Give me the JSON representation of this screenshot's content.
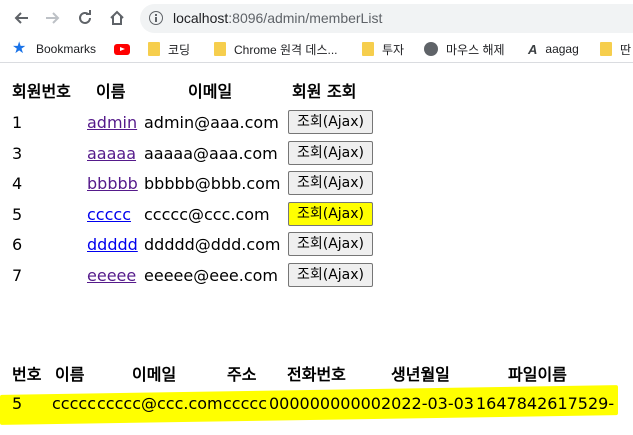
{
  "browser": {
    "url_host": "localhost",
    "url_path": ":8096/admin/memberList",
    "bookmarks": [
      {
        "icon": "star-icon",
        "label": "Bookmarks"
      },
      {
        "icon": "youtube-icon",
        "label": ""
      },
      {
        "icon": "folder-icon",
        "label": "코딩"
      },
      {
        "icon": "folder-icon",
        "label": "Chrome 원격 데스..."
      },
      {
        "icon": "folder-icon",
        "label": "투자"
      },
      {
        "icon": "globe-icon",
        "label": "마우스 해제"
      },
      {
        "icon": "aa-icon",
        "label": "aagag"
      },
      {
        "icon": "folder-icon",
        "label": "딴"
      }
    ]
  },
  "member_table": {
    "headers": [
      "회원번호",
      "이름",
      "이메일",
      "회원 조회"
    ],
    "rows": [
      {
        "id": "1",
        "name": "admin",
        "email": "admin@aaa.com",
        "button": "조회(Ajax)"
      },
      {
        "id": "3",
        "name": "aaaaa",
        "email": "aaaaa@aaa.com",
        "button": "조회(Ajax)"
      },
      {
        "id": "4",
        "name": "bbbbb",
        "email": "bbbbb@bbb.com",
        "button": "조회(Ajax)"
      },
      {
        "id": "5",
        "name": "ccccc",
        "email": "ccccc@ccc.com",
        "button": "조회(Ajax)"
      },
      {
        "id": "6",
        "name": "ddddd",
        "email": "ddddd@ddd.com",
        "button": "조회(Ajax)"
      },
      {
        "id": "7",
        "name": "eeeee",
        "email": "eeeee@eee.com",
        "button": "조회(Ajax)"
      }
    ]
  },
  "detail_table": {
    "headers": [
      "번호",
      "이름",
      "이메일",
      "주소",
      "전화번호",
      "생년월일",
      "파일이름"
    ],
    "row": [
      "5",
      "ccccc",
      "ccccc@ccc.com",
      "ccccc",
      "00000000000",
      "2022-03-03",
      "1647842617529-"
    ]
  },
  "colors": {
    "highlight": "#ffff00",
    "visited_link": "#551a8b",
    "link": "#0000ee"
  }
}
